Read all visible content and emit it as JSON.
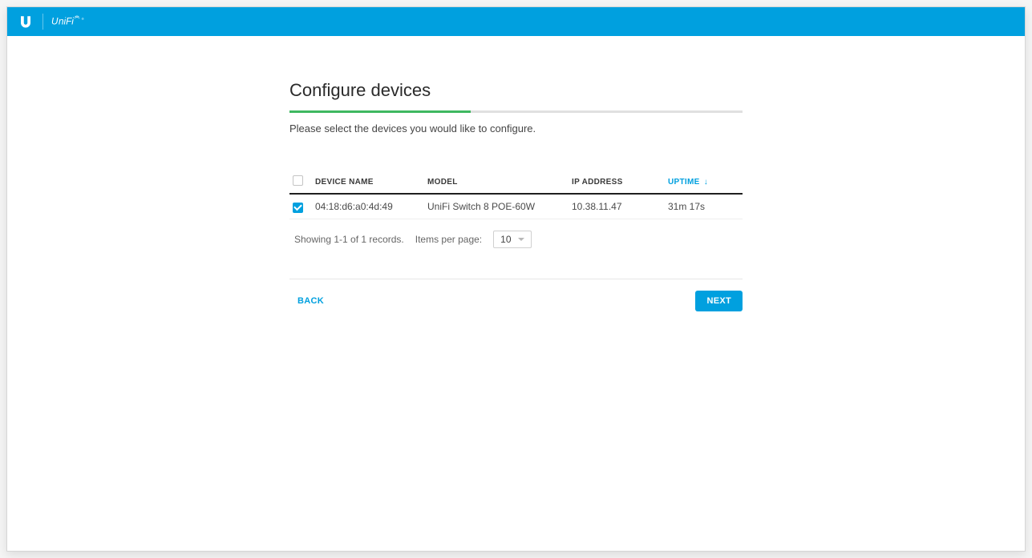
{
  "header": {
    "brand": "UniFi"
  },
  "page": {
    "title": "Configure devices",
    "instruction": "Please select the devices you would like to configure."
  },
  "table": {
    "headers": {
      "device_name": "DEVICE NAME",
      "model": "MODEL",
      "ip_address": "IP ADDRESS",
      "uptime": "UPTIME"
    },
    "rows": [
      {
        "checked": true,
        "device_name": "04:18:d6:a0:4d:49",
        "model": "UniFi Switch 8 POE-60W",
        "ip_address": "10.38.11.47",
        "uptime": "31m 17s"
      }
    ],
    "footer": {
      "showing": "Showing 1-1 of 1 records.",
      "items_per_page_label": "Items per page:",
      "items_per_page_value": "10"
    }
  },
  "actions": {
    "back": "BACK",
    "next": "NEXT"
  }
}
